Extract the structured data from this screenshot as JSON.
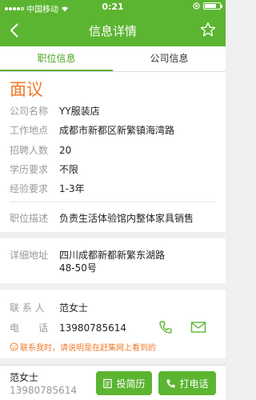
{
  "status_bar": {
    "carrier": "中国移动",
    "time": "0:21"
  },
  "nav": {
    "title": "信息详情"
  },
  "tabs": [
    {
      "label": "职位信息",
      "active": true
    },
    {
      "label": "公司信息",
      "active": false
    }
  ],
  "job": {
    "salary": "面议",
    "company": {
      "label": "公司名称",
      "value": "YY服装店"
    },
    "location": {
      "label": "工作地点",
      "value": "成都市新都区新繁镇海湾路"
    },
    "headcount": {
      "label": "招聘人数",
      "value": "20"
    },
    "education": {
      "label": "学历要求",
      "value": "不限"
    },
    "experience": {
      "label": "经验要求",
      "value": "1-3年"
    },
    "description": {
      "label": "职位描述",
      "value": "负责生活体验馆内整体家具销售"
    }
  },
  "address": {
    "label": "详细地址",
    "line1": "四川成都新都新繁东湖路",
    "line2": "48-50号"
  },
  "contact": {
    "person_label": "联 系 人",
    "person": "范女士",
    "phone_label": "电　　话",
    "phone": "13980785614",
    "notice": "联系我时，请说明是在赶集网上看到的"
  },
  "bottom_bar": {
    "name": "范女士",
    "phone": "13980785614",
    "resume_label": "投简历",
    "call_label": "打电话"
  },
  "colors": {
    "brand_green": "#5cb531",
    "accent_orange": "#f07a2a"
  }
}
